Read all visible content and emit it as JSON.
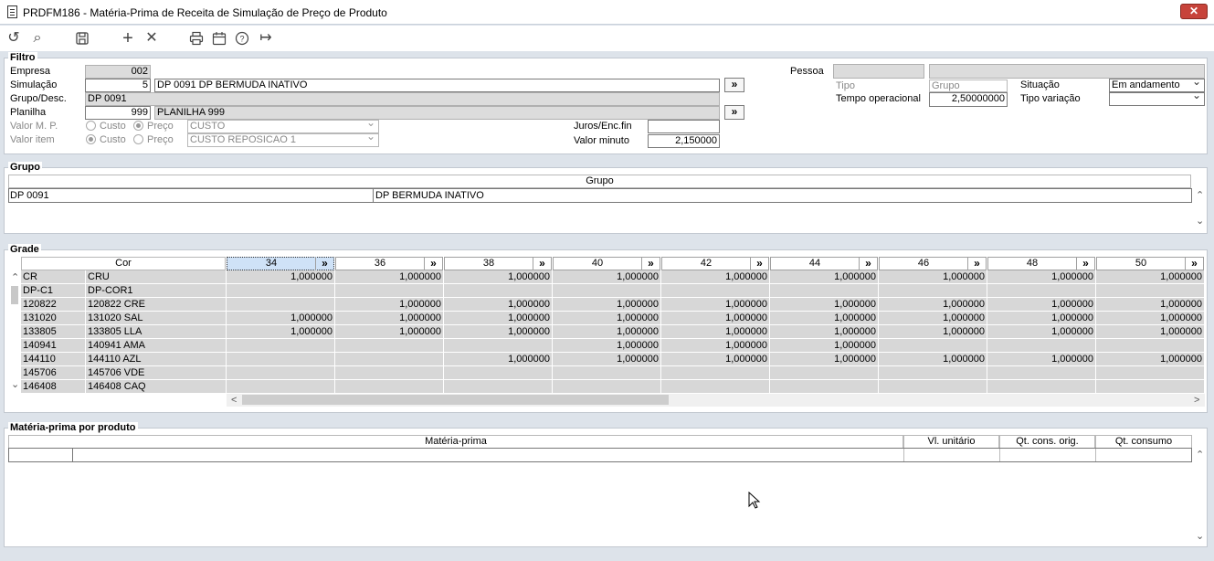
{
  "window": {
    "title": "PRDFM186 - Matéria-Prima de Receita de Simulação de Preço de Produto",
    "close": "✕"
  },
  "toolbar": {
    "undo": "↺",
    "search": "⌕",
    "save": "🖫",
    "add": "+",
    "delete": "✕",
    "print": "⎙",
    "calendar": "▦",
    "help": "?",
    "exit": "↦"
  },
  "filtro": {
    "legend": "Filtro",
    "empresa_label": "Empresa",
    "empresa": "002",
    "simulacao_label": "Simulação",
    "simulacao": "5",
    "simulacao_desc": "DP 0091 DP BERMUDA INATIVO",
    "grupo_label": "Grupo/Desc.",
    "grupo": "DP 0091",
    "planilha_label": "Planilha",
    "planilha": "999",
    "planilha_desc": "PLANILHA 999",
    "valor_mp_label": "Valor M. P.",
    "valor_item_label": "Valor item",
    "custo": "Custo",
    "preco": "Preço",
    "valor_mp_select": "CUSTO",
    "valor_item_select": "CUSTO REPOSICAO 1",
    "juros_label": "Juros/Enc.fin",
    "juros": "",
    "valor_minuto_label": "Valor minuto",
    "valor_minuto": "2,150000",
    "pessoa_label": "Pessoa",
    "pessoa": "",
    "pessoa_desc": "",
    "tipo_label": "Tipo",
    "grupo_placeholder": "Grupo",
    "tempo_label": "Tempo operacional",
    "tempo": "2,50000000",
    "situacao_label": "Situação",
    "situacao": "Em andamento",
    "tipo_variacao_label": "Tipo variação",
    "tipo_variacao": "",
    "go": "»"
  },
  "grupo_panel": {
    "legend": "Grupo",
    "header": "Grupo",
    "row": {
      "code": "DP 0091",
      "desc": "DP BERMUDA INATIVO"
    }
  },
  "grade": {
    "legend": "Grade",
    "cor_header": "Cor",
    "sizes": [
      "34",
      "36",
      "38",
      "40",
      "42",
      "44",
      "46",
      "48",
      "50"
    ],
    "dbl": "»",
    "rows": [
      {
        "code": "CR",
        "name": "CRU",
        "vals": [
          "1,000000",
          "1,000000",
          "1,000000",
          "1,000000",
          "1,000000",
          "1,000000",
          "1,000000",
          "1,000000",
          "1,000000"
        ]
      },
      {
        "code": "DP-C1",
        "name": "DP-COR1",
        "vals": [
          "",
          "",
          "",
          "",
          "",
          "",
          "",
          "",
          ""
        ]
      },
      {
        "code": "120822",
        "name": "120822 CRE",
        "vals": [
          "",
          "1,000000",
          "1,000000",
          "1,000000",
          "1,000000",
          "1,000000",
          "1,000000",
          "1,000000",
          "1,000000"
        ]
      },
      {
        "code": "131020",
        "name": "131020 SAL",
        "vals": [
          "1,000000",
          "1,000000",
          "1,000000",
          "1,000000",
          "1,000000",
          "1,000000",
          "1,000000",
          "1,000000",
          "1,000000"
        ]
      },
      {
        "code": "133805",
        "name": "133805 LLA",
        "vals": [
          "1,000000",
          "1,000000",
          "1,000000",
          "1,000000",
          "1,000000",
          "1,000000",
          "1,000000",
          "1,000000",
          "1,000000"
        ]
      },
      {
        "code": "140941",
        "name": "140941 AMA",
        "vals": [
          "",
          "",
          "",
          "1,000000",
          "1,000000",
          "1,000000",
          "",
          "",
          ""
        ]
      },
      {
        "code": "144110",
        "name": "144110 AZL",
        "vals": [
          "",
          "",
          "1,000000",
          "1,000000",
          "1,000000",
          "1,000000",
          "1,000000",
          "1,000000",
          "1,000000"
        ]
      },
      {
        "code": "145706",
        "name": "145706 VDE",
        "vals": [
          "",
          "",
          "",
          "",
          "",
          "",
          "",
          "",
          ""
        ]
      },
      {
        "code": "146408",
        "name": "146408 CAQ",
        "vals": [
          "",
          "",
          "",
          "",
          "",
          "",
          "",
          "",
          ""
        ]
      }
    ]
  },
  "materia": {
    "legend": "Matéria-prima por produto",
    "headers": [
      "Matéria-prima",
      "Vl. unitário",
      "Qt. cons. orig.",
      "Qt. consumo"
    ]
  },
  "scroll": {
    "up": "⌃",
    "down": "⌄",
    "left": "<",
    "right": ">"
  }
}
